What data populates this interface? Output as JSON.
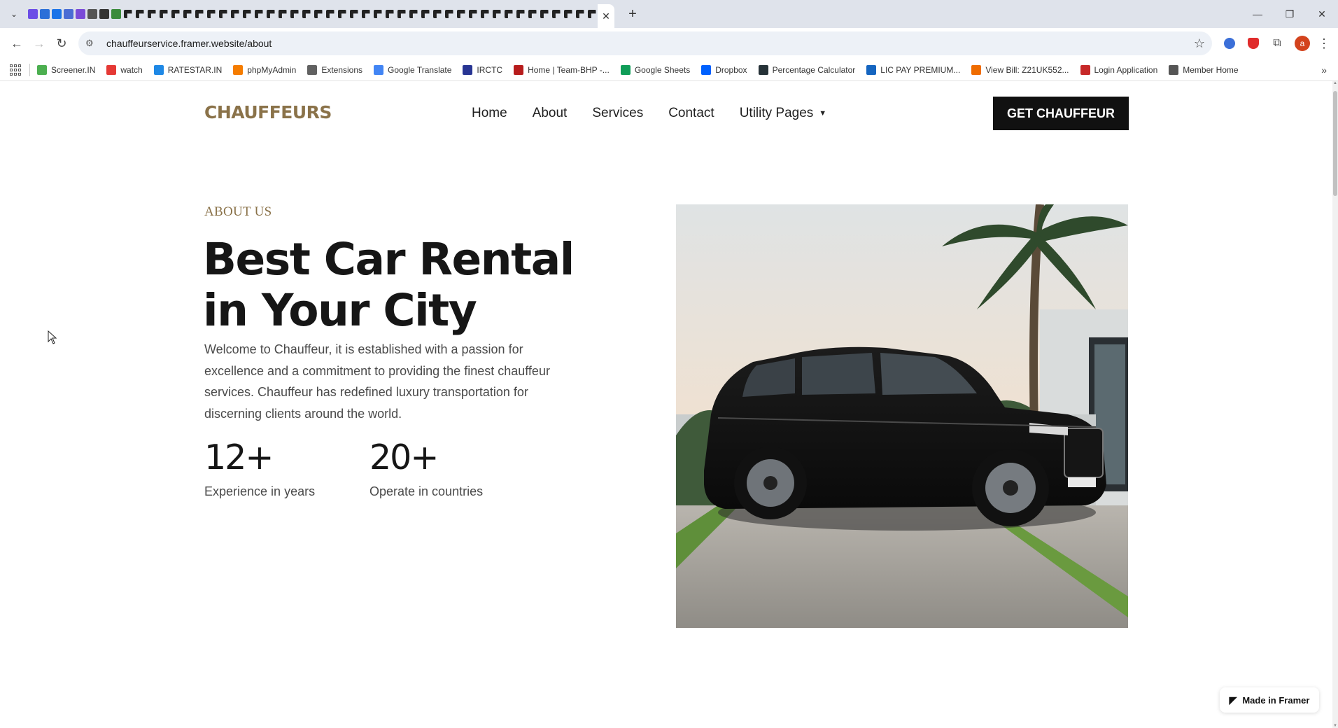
{
  "browser": {
    "tabs_count": 48,
    "active_tab_close": "✕",
    "new_tab": "+",
    "window": {
      "minimize": "—",
      "restore": "❐",
      "close": "✕"
    },
    "url": "chauffeurservice.framer.website/about",
    "profile_initial": "a",
    "bookmarks": [
      {
        "label": "Screener.IN",
        "color": "#4caf50"
      },
      {
        "label": "watch",
        "color": "#e53935"
      },
      {
        "label": "RATESTAR.IN",
        "color": "#1e88e5"
      },
      {
        "label": "phpMyAdmin",
        "color": "#f57c00"
      },
      {
        "label": "Extensions",
        "color": "#616161"
      },
      {
        "label": "Google Translate",
        "color": "#4285f4"
      },
      {
        "label": "IRCTC",
        "color": "#283593"
      },
      {
        "label": "Home | Team-BHP -...",
        "color": "#b71c1c"
      },
      {
        "label": "Google Sheets",
        "color": "#0f9d58"
      },
      {
        "label": "Dropbox",
        "color": "#0061fe"
      },
      {
        "label": "Percentage Calculator",
        "color": "#263238"
      },
      {
        "label": "LIC PAY PREMIUM...",
        "color": "#1565c0"
      },
      {
        "label": "View Bill: Z21UK552...",
        "color": "#ef6c00"
      },
      {
        "label": "Login Application",
        "color": "#c62828"
      },
      {
        "label": "Member Home",
        "color": "#555555"
      }
    ],
    "bookmarks_more": "»"
  },
  "site": {
    "logo": "CHAUFFEURS",
    "nav": [
      "Home",
      "About",
      "Services",
      "Contact",
      "Utility Pages"
    ],
    "cta": "GET CHAUFFEUR",
    "eyebrow": "ABOUT US",
    "title": "Best Car Rental in Your City",
    "intro": "Welcome to Chauffeur, it is established with a passion for excellence and a commitment to providing the finest chauffeur services. Chauffeur has redefined luxury transportation for discerning clients around the world.",
    "stats": [
      {
        "num": "12+",
        "label": "Experience in years"
      },
      {
        "num": "20+",
        "label": "Operate in countries"
      }
    ],
    "badge": "Made in Framer"
  },
  "colors": {
    "accent": "#8a7249",
    "cta_bg": "#111111"
  }
}
